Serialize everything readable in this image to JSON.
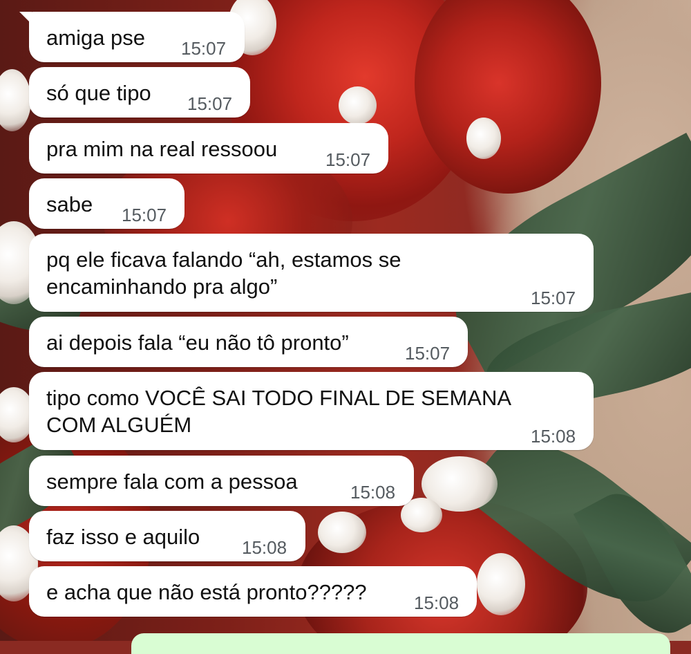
{
  "messages": [
    {
      "text": "amiga pse",
      "time": "15:07"
    },
    {
      "text": "só que tipo",
      "time": "15:07"
    },
    {
      "text": "pra mim na real ressoou",
      "time": "15:07"
    },
    {
      "text": "sabe",
      "time": "15:07"
    },
    {
      "line1": "pq ele ficava falando “ah, estamos se",
      "line2": "encaminhando pra algo”",
      "time": "15:07"
    },
    {
      "text": "ai depois fala “eu não tô pronto”",
      "time": "15:07"
    },
    {
      "line1": "tipo como VOCÊ SAI TODO FINAL DE SEMANA",
      "line2": "COM ALGUÉM",
      "time": "15:08"
    },
    {
      "text": "sempre fala com a pessoa",
      "time": "15:08"
    },
    {
      "text": "faz isso e aquilo",
      "time": "15:08"
    },
    {
      "text": "e acha que não está pronto?????",
      "time": "15:08"
    }
  ],
  "colors": {
    "incoming_bubble": "#ffffff",
    "outgoing_bubble": "#d9fdd3",
    "timestamp": "#555b60"
  }
}
